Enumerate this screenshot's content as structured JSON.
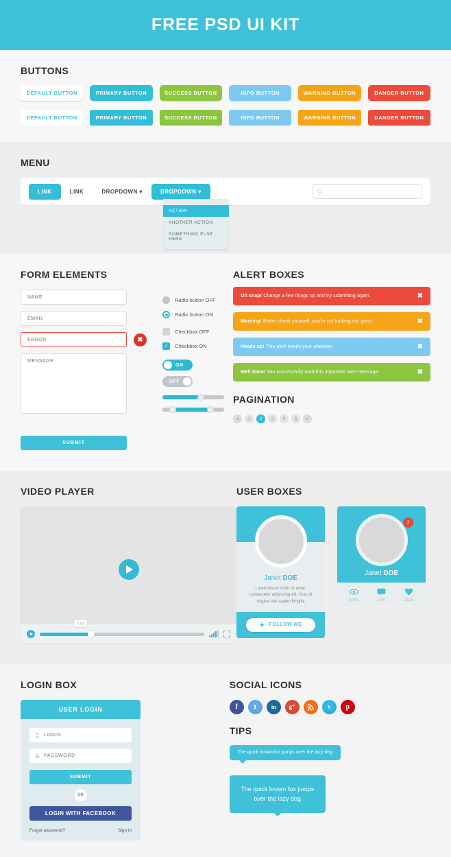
{
  "header": {
    "title": "FREE PSD UI KIT"
  },
  "buttons": {
    "section_title": "BUTTONS",
    "items": [
      {
        "label": "DEFAULT BUTTON",
        "style": "default",
        "color": "#ffffff"
      },
      {
        "label": "PRIMARY BUTTON",
        "style": "primary",
        "color": "#34bdd8"
      },
      {
        "label": "SUCCESS BUTTON",
        "style": "success",
        "color": "#8cc63e"
      },
      {
        "label": "INFO BUTTON",
        "style": "info",
        "color": "#7ec9ef"
      },
      {
        "label": "WARNING BUTTON",
        "style": "warning",
        "color": "#f5a317"
      },
      {
        "label": "DANGER BUTTON",
        "style": "danger",
        "color": "#ec4a3b"
      }
    ]
  },
  "menu": {
    "section_title": "MENU",
    "items": [
      {
        "label": "LINK",
        "active": true
      },
      {
        "label": "LINK",
        "active": false
      },
      {
        "label": "DROPDOWN ▾",
        "active": false
      },
      {
        "label": "DROPDOWN ▾",
        "active": true
      }
    ],
    "search": {
      "placeholder": "",
      "icon": "search-icon"
    },
    "dropdown": {
      "items": [
        {
          "label": "ACTION",
          "active": true
        },
        {
          "label": "ANOTHER ACTION",
          "active": false
        },
        {
          "label": "SOMETHING ELSE HERE",
          "active": false
        }
      ]
    }
  },
  "form": {
    "section_title": "FORM ELEMENTS",
    "name_placeholder": "NAME",
    "email_placeholder": "EMAIL",
    "error_value": "ERROR",
    "message_placeholder": "MESSAGE",
    "submit_label": "SUBMIT",
    "error_icon": "✖",
    "controls": {
      "radio_off_label": "Radio button OFF",
      "radio_on_label": "Radio button ON",
      "checkbox_off_label": "Checkbox OFF",
      "checkbox_on_label": "Checkbox ON",
      "toggle_on_label": "ON",
      "toggle_off_label": "OFF",
      "slider_single_value": 62,
      "slider_range_low": 17,
      "slider_range_high": 78
    }
  },
  "alerts": {
    "section_title": "ALERT BOXES",
    "close_icon": "✖",
    "items": [
      {
        "type": "danger",
        "strong": "Oh snap!",
        "text": "Change a few things up and try submitting again.",
        "color": "#ec4a3b"
      },
      {
        "type": "warning",
        "strong": "Warning!",
        "text": "Better check yourself, you're not looking too good.",
        "color": "#f5a317"
      },
      {
        "type": "info",
        "strong": "Heads up!",
        "text": "This alert needs your attention.",
        "color": "#7ec9ef"
      },
      {
        "type": "success",
        "strong": "Well done!",
        "text": "You successfully read this important alert message.",
        "color": "#8cc63e"
      }
    ]
  },
  "pagination": {
    "section_title": "PAGINATION",
    "prev_icon": "◂",
    "next_icon": "▸",
    "pages": [
      "1",
      "2",
      "3",
      "4",
      "5"
    ],
    "active_page": "2"
  },
  "video": {
    "section_title": "VIDEO PLAYER",
    "time_tooltip": "1:02",
    "progress_percent": 31
  },
  "user_boxes": {
    "section_title": "USER BOXES",
    "card1": {
      "name_first": "Janet ",
      "name_last": "DOE",
      "bio": "Lorem ipsum dolor sit amet, consectetur adipiscing elit. Cras id magna non sapien fringilla",
      "follow_label": "FOLLOW ME",
      "plus_icon": "+"
    },
    "card2": {
      "name_first": "Janet ",
      "name_last": "DOE",
      "badge": "3",
      "stats": [
        {
          "icon": "eye-icon",
          "value": "5435"
        },
        {
          "icon": "comment-icon",
          "value": "156"
        },
        {
          "icon": "heart-icon",
          "value": "2515"
        }
      ]
    }
  },
  "login": {
    "section_title": "LOGIN BOX",
    "header": "USER LOGIN",
    "login_placeholder": "LOGIN",
    "password_placeholder": "PASSWORD",
    "submit_label": "SUBMIT",
    "or_label": "OR",
    "facebook_label": "LOGIN WITH FACEBOOK",
    "forgot_label": "Forgot password?",
    "signin_label": "Sign in"
  },
  "social": {
    "section_title": "SOCIAL ICONS",
    "items": [
      {
        "name": "facebook-icon",
        "glyph": "f",
        "color": "#3f559c"
      },
      {
        "name": "twitter-icon",
        "glyph": "t",
        "color": "#63ace5"
      },
      {
        "name": "linkedin-icon",
        "glyph": "in",
        "color": "#1d6b9e"
      },
      {
        "name": "googleplus-icon",
        "glyph": "g⁺",
        "color": "#dc4a38"
      },
      {
        "name": "rss-icon",
        "glyph": "្",
        "color": "#f3701b"
      },
      {
        "name": "vimeo-icon",
        "glyph": "v",
        "color": "#2fb8e8"
      },
      {
        "name": "pinterest-icon",
        "glyph": "p",
        "color": "#d4020d"
      }
    ]
  },
  "tips": {
    "section_title": "TIPS",
    "tip_one": "The quick brown fox jumps over the lazy dog",
    "tip_two": "The quick brown fox jumps over the lazy dog"
  }
}
